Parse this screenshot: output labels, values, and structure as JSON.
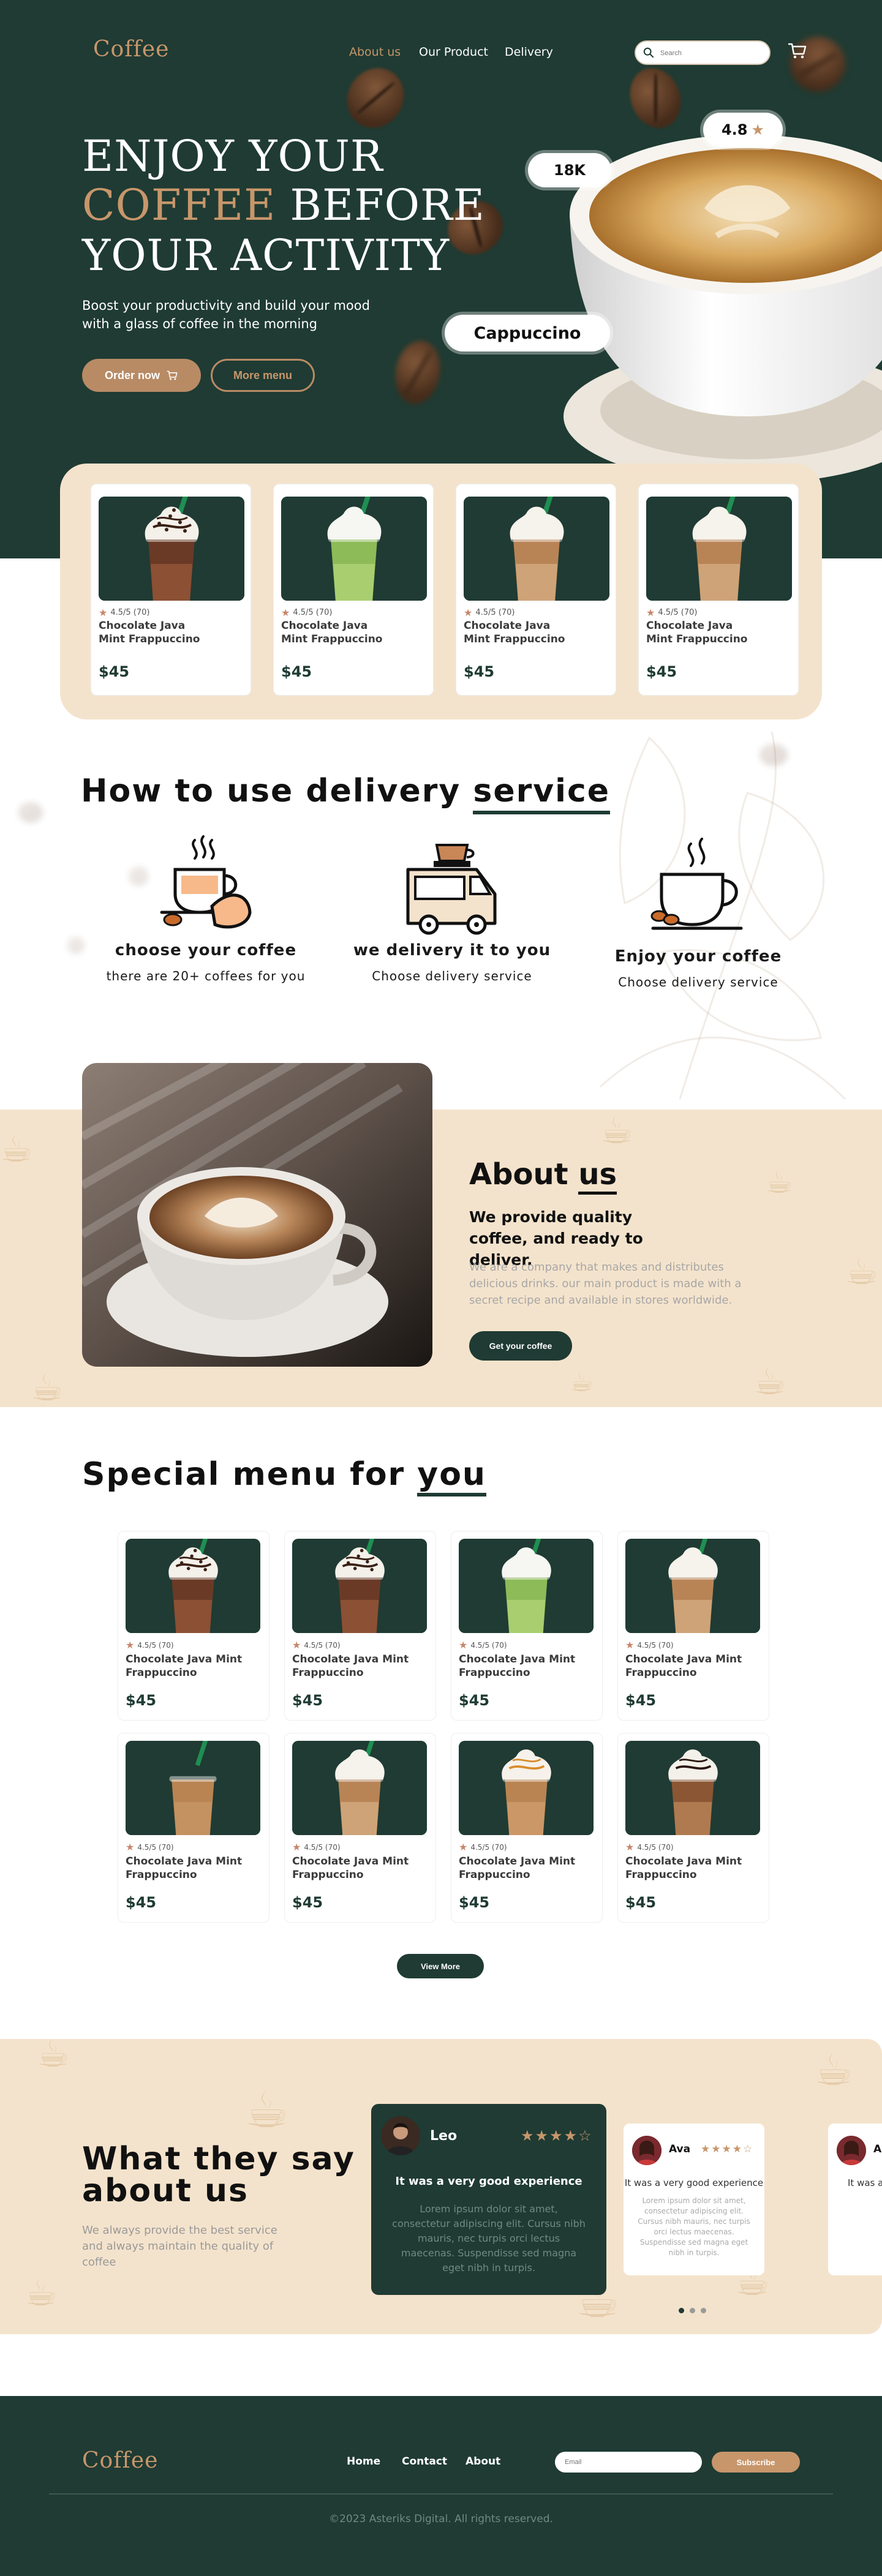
{
  "brand": {
    "logo": "Coffee"
  },
  "nav": {
    "about": "About us",
    "product": "Our Product",
    "delivery": "Delivery"
  },
  "search": {
    "placeholder": "Search"
  },
  "hero": {
    "line1": "ENJOY YOUR",
    "line2_accent": "COFFEE",
    "line2_rest": " BEFORE",
    "line3": "YOUR ACTIVITY",
    "subtitle": "Boost your productivity and build your mood with a glass of coffee in the morning",
    "order_button": "Order now",
    "more_button": "More menu",
    "rating_badge": "4.8",
    "likes_badge": "18K",
    "product_badge": "Cappuccino"
  },
  "featured": [
    {
      "rating": "4.5/5 (70)",
      "name_line1": "Chocolate Java",
      "name_line2": "Mint Frappuccino",
      "price": "$45",
      "drink": "chocolate"
    },
    {
      "rating": "4.5/5 (70)",
      "name_line1": "Chocolate Java",
      "name_line2": "Mint Frappuccino",
      "price": "$45",
      "drink": "matcha"
    },
    {
      "rating": "4.5/5 (70)",
      "name_line1": "Chocolate Java",
      "name_line2": "Mint Frappuccino",
      "price": "$45",
      "drink": "latte"
    },
    {
      "rating": "4.5/5 (70)",
      "name_line1": "Chocolate Java",
      "name_line2": "Mint Frappuccino",
      "price": "$45",
      "drink": "latte"
    }
  ],
  "how": {
    "title_a": "How to use delivery ",
    "title_u": "service",
    "steps": [
      {
        "title": "choose your coffee",
        "subtitle": "there are 20+ coffees for you"
      },
      {
        "title": "we delivery it to you",
        "subtitle": "Choose delivery service"
      },
      {
        "title": "Enjoy your coffee",
        "subtitle": "Choose delivery service"
      }
    ]
  },
  "about": {
    "title_a": "About ",
    "title_u": "us",
    "subtitle": "We provide quality coffee, and ready to deliver.",
    "description": "We are a company that makes and distributes delicious drinks. our main product is made with a secret recipe and available in stores worldwide.",
    "button": "Get your coffee"
  },
  "special": {
    "title_a": "Special menu for ",
    "title_u": "you",
    "items": [
      {
        "rating": "4.5/5 (70)",
        "name_line1": "Chocolate Java Mint",
        "name_line2": "Frappuccino",
        "price": "$45",
        "drink": "chocolate"
      },
      {
        "rating": "4.5/5 (70)",
        "name_line1": "Chocolate Java Mint",
        "name_line2": "Frappuccino",
        "price": "$45",
        "drink": "chocolate"
      },
      {
        "rating": "4.5/5 (70)",
        "name_line1": "Chocolate Java Mint",
        "name_line2": "Frappuccino",
        "price": "$45",
        "drink": "matcha"
      },
      {
        "rating": "4.5/5 (70)",
        "name_line1": "Chocolate Java Mint",
        "name_line2": "Frappuccino",
        "price": "$45",
        "drink": "latte"
      },
      {
        "rating": "4.5/5 (70)",
        "name_line1": "Chocolate Java Mint",
        "name_line2": "Frappuccino",
        "price": "$45",
        "drink": "iced"
      },
      {
        "rating": "4.5/5 (70)",
        "name_line1": "Chocolate Java Mint",
        "name_line2": "Frappuccino",
        "price": "$45",
        "drink": "latte"
      },
      {
        "rating": "4.5/5 (70)",
        "name_line1": "Chocolate Java Mint",
        "name_line2": "Frappuccino",
        "price": "$45",
        "drink": "caramel"
      },
      {
        "rating": "4.5/5 (70)",
        "name_line1": "Chocolate Java Mint",
        "name_line2": "Frappuccino",
        "price": "$45",
        "drink": "mocha"
      }
    ],
    "view_more": "View More"
  },
  "testimonials": {
    "title": "What they say about us",
    "subtitle": "We always provide the best service and always maintain the quality of coffee",
    "main": {
      "name": "Leo",
      "stars": 4,
      "headline": "It was a very good experience",
      "body": "Lorem ipsum dolor sit amet, consectetur adipiscing elit. Cursus nibh mauris, nec turpis orci lectus maecenas. Suspendisse sed magna eget nibh in turpis."
    },
    "side": [
      {
        "name": "Ava",
        "stars": 4,
        "headline": "It was a very good experience",
        "body": "Lorem ipsum dolor sit amet, consectetur adipiscing elit. Cursus nibh mauris, nec turpis orci lectus maecenas. Suspendisse sed magna eget nibh in turpis."
      },
      {
        "name": "A",
        "headline": "It was a"
      }
    ]
  },
  "footer": {
    "logo": "Coffee",
    "home": "Home",
    "contact": "Contact",
    "about": "About",
    "email_placeholder": "Email",
    "subscribe": "Subscribe",
    "copyright": "©2023 Asteriks Digital. All rights reserved."
  },
  "colors": {
    "primary": "#1f3b33",
    "accent": "#c7966b",
    "cream": "#f4e3cc",
    "button_brown": "#b88b65"
  }
}
